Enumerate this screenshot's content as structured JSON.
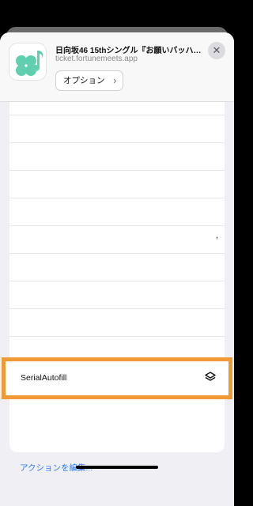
{
  "header": {
    "title": "日向坂46 15thシングル『お願いバッハ…",
    "subtitle": "ticket.fortunemeets.app",
    "options_label": "オプション",
    "app_icon": "music-note-clover-icon",
    "close_icon": "close-icon",
    "accent": "#5fcfb0"
  },
  "list": {
    "row_trailing_text": ","
  },
  "action": {
    "label": "SerialAutofill",
    "icon": "layers-icon",
    "highlight_color": "#f09a35"
  },
  "footer": {
    "edit_label": "アクションを編集..."
  }
}
